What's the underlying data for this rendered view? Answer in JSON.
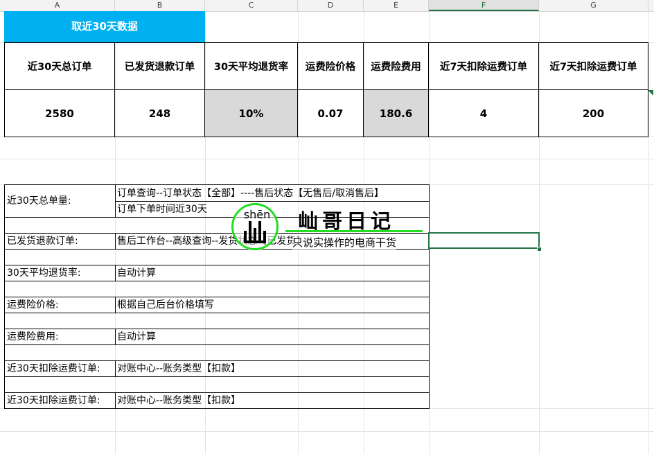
{
  "columns": [
    "A",
    "B",
    "C",
    "D",
    "E",
    "F",
    "G"
  ],
  "selected_column": "F",
  "banner": "取近30天数据",
  "summary": {
    "headers": [
      "近30天总订单",
      "已发货退款订单",
      "30天平均退货率",
      "运费险价格",
      "运费险费用",
      "近7天扣除运费订单",
      "近7天扣除运费订单"
    ],
    "values": [
      "2580",
      "248",
      "10%",
      "0.07",
      "180.6",
      "4",
      "200"
    ]
  },
  "notes": [
    {
      "label": "近30天总单量:",
      "lines": [
        "订单查询--订单状态【全部】----售后状态【无售后/取消售后】",
        "订单下单时间近30天"
      ]
    },
    {
      "label": "已发货退款订单:",
      "lines": [
        "售后工作台--高级查询--发货状态【已发货】"
      ]
    },
    {
      "label": "30天平均退货率:",
      "lines": [
        "自动计算"
      ]
    },
    {
      "label": "运费险价格:",
      "lines": [
        "根据自己后台价格填写"
      ]
    },
    {
      "label": "运费险费用:",
      "lines": [
        "自动计算"
      ]
    },
    {
      "label": "近30天扣除运费订单:",
      "lines": [
        "对账中心--账务类型【扣款】"
      ]
    },
    {
      "label": "近30天扣除运费订单:",
      "lines": [
        "对账中心--账务类型【扣款】"
      ]
    }
  ],
  "watermark": {
    "pinyin": "shēn",
    "title": "屾哥日记",
    "tagline": "只说实操作的电商干货",
    "accent": "#22dd22"
  },
  "colors": {
    "banner": "#00b0f0",
    "highlight_cells": "#d9d9d9",
    "selection": "#217346"
  }
}
